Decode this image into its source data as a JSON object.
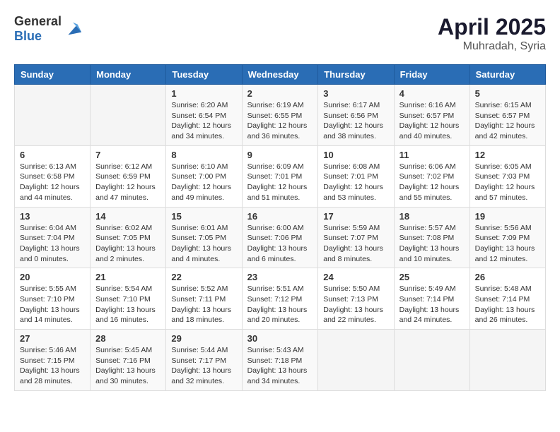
{
  "header": {
    "logo_general": "General",
    "logo_blue": "Blue",
    "month": "April 2025",
    "location": "Muhradah, Syria"
  },
  "weekdays": [
    "Sunday",
    "Monday",
    "Tuesday",
    "Wednesday",
    "Thursday",
    "Friday",
    "Saturday"
  ],
  "weeks": [
    [
      {
        "day": "",
        "info": ""
      },
      {
        "day": "",
        "info": ""
      },
      {
        "day": "1",
        "info": "Sunrise: 6:20 AM\nSunset: 6:54 PM\nDaylight: 12 hours and 34 minutes."
      },
      {
        "day": "2",
        "info": "Sunrise: 6:19 AM\nSunset: 6:55 PM\nDaylight: 12 hours and 36 minutes."
      },
      {
        "day": "3",
        "info": "Sunrise: 6:17 AM\nSunset: 6:56 PM\nDaylight: 12 hours and 38 minutes."
      },
      {
        "day": "4",
        "info": "Sunrise: 6:16 AM\nSunset: 6:57 PM\nDaylight: 12 hours and 40 minutes."
      },
      {
        "day": "5",
        "info": "Sunrise: 6:15 AM\nSunset: 6:57 PM\nDaylight: 12 hours and 42 minutes."
      }
    ],
    [
      {
        "day": "6",
        "info": "Sunrise: 6:13 AM\nSunset: 6:58 PM\nDaylight: 12 hours and 44 minutes."
      },
      {
        "day": "7",
        "info": "Sunrise: 6:12 AM\nSunset: 6:59 PM\nDaylight: 12 hours and 47 minutes."
      },
      {
        "day": "8",
        "info": "Sunrise: 6:10 AM\nSunset: 7:00 PM\nDaylight: 12 hours and 49 minutes."
      },
      {
        "day": "9",
        "info": "Sunrise: 6:09 AM\nSunset: 7:01 PM\nDaylight: 12 hours and 51 minutes."
      },
      {
        "day": "10",
        "info": "Sunrise: 6:08 AM\nSunset: 7:01 PM\nDaylight: 12 hours and 53 minutes."
      },
      {
        "day": "11",
        "info": "Sunrise: 6:06 AM\nSunset: 7:02 PM\nDaylight: 12 hours and 55 minutes."
      },
      {
        "day": "12",
        "info": "Sunrise: 6:05 AM\nSunset: 7:03 PM\nDaylight: 12 hours and 57 minutes."
      }
    ],
    [
      {
        "day": "13",
        "info": "Sunrise: 6:04 AM\nSunset: 7:04 PM\nDaylight: 13 hours and 0 minutes."
      },
      {
        "day": "14",
        "info": "Sunrise: 6:02 AM\nSunset: 7:05 PM\nDaylight: 13 hours and 2 minutes."
      },
      {
        "day": "15",
        "info": "Sunrise: 6:01 AM\nSunset: 7:05 PM\nDaylight: 13 hours and 4 minutes."
      },
      {
        "day": "16",
        "info": "Sunrise: 6:00 AM\nSunset: 7:06 PM\nDaylight: 13 hours and 6 minutes."
      },
      {
        "day": "17",
        "info": "Sunrise: 5:59 AM\nSunset: 7:07 PM\nDaylight: 13 hours and 8 minutes."
      },
      {
        "day": "18",
        "info": "Sunrise: 5:57 AM\nSunset: 7:08 PM\nDaylight: 13 hours and 10 minutes."
      },
      {
        "day": "19",
        "info": "Sunrise: 5:56 AM\nSunset: 7:09 PM\nDaylight: 13 hours and 12 minutes."
      }
    ],
    [
      {
        "day": "20",
        "info": "Sunrise: 5:55 AM\nSunset: 7:10 PM\nDaylight: 13 hours and 14 minutes."
      },
      {
        "day": "21",
        "info": "Sunrise: 5:54 AM\nSunset: 7:10 PM\nDaylight: 13 hours and 16 minutes."
      },
      {
        "day": "22",
        "info": "Sunrise: 5:52 AM\nSunset: 7:11 PM\nDaylight: 13 hours and 18 minutes."
      },
      {
        "day": "23",
        "info": "Sunrise: 5:51 AM\nSunset: 7:12 PM\nDaylight: 13 hours and 20 minutes."
      },
      {
        "day": "24",
        "info": "Sunrise: 5:50 AM\nSunset: 7:13 PM\nDaylight: 13 hours and 22 minutes."
      },
      {
        "day": "25",
        "info": "Sunrise: 5:49 AM\nSunset: 7:14 PM\nDaylight: 13 hours and 24 minutes."
      },
      {
        "day": "26",
        "info": "Sunrise: 5:48 AM\nSunset: 7:14 PM\nDaylight: 13 hours and 26 minutes."
      }
    ],
    [
      {
        "day": "27",
        "info": "Sunrise: 5:46 AM\nSunset: 7:15 PM\nDaylight: 13 hours and 28 minutes."
      },
      {
        "day": "28",
        "info": "Sunrise: 5:45 AM\nSunset: 7:16 PM\nDaylight: 13 hours and 30 minutes."
      },
      {
        "day": "29",
        "info": "Sunrise: 5:44 AM\nSunset: 7:17 PM\nDaylight: 13 hours and 32 minutes."
      },
      {
        "day": "30",
        "info": "Sunrise: 5:43 AM\nSunset: 7:18 PM\nDaylight: 13 hours and 34 minutes."
      },
      {
        "day": "",
        "info": ""
      },
      {
        "day": "",
        "info": ""
      },
      {
        "day": "",
        "info": ""
      }
    ]
  ]
}
